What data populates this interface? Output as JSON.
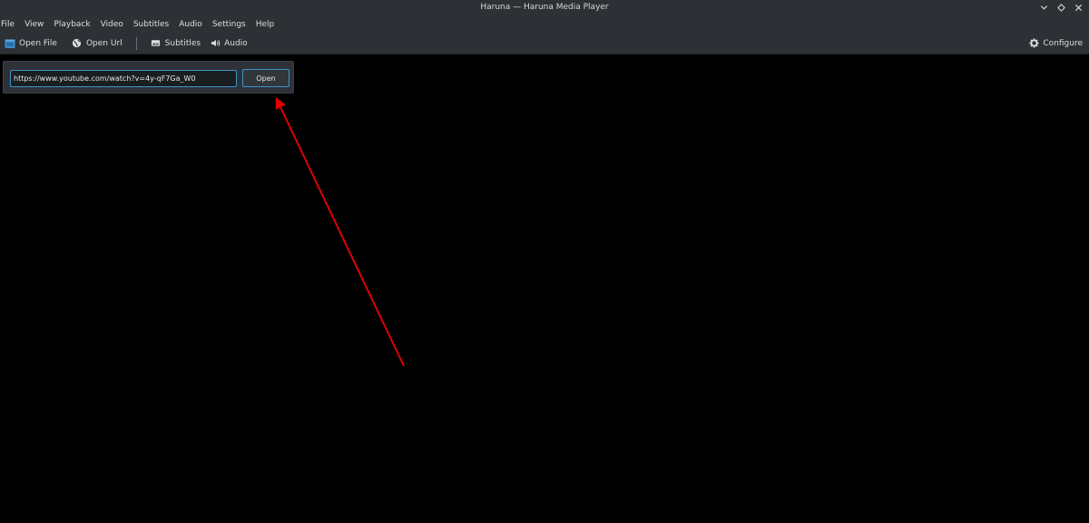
{
  "window": {
    "title": "Haruna — Haruna Media Player"
  },
  "menu": {
    "items": [
      "File",
      "View",
      "Playback",
      "Video",
      "Subtitles",
      "Audio",
      "Settings",
      "Help"
    ]
  },
  "toolbar": {
    "open_file": {
      "label": "Open File",
      "icon": "folder-icon"
    },
    "open_url": {
      "label": "Open Url",
      "icon": "globe-icon"
    },
    "subtitles": {
      "label": "Subtitles",
      "icon": "subtitles-icon"
    },
    "audio": {
      "label": "Audio",
      "icon": "speaker-icon"
    },
    "configure": {
      "label": "Configure",
      "icon": "gear-icon"
    }
  },
  "url_dialog": {
    "value": "https://www.youtube.com/watch?v=4y-qF7Ga_W0",
    "open_label": "Open"
  },
  "annotation": {
    "color": "#e00000"
  }
}
